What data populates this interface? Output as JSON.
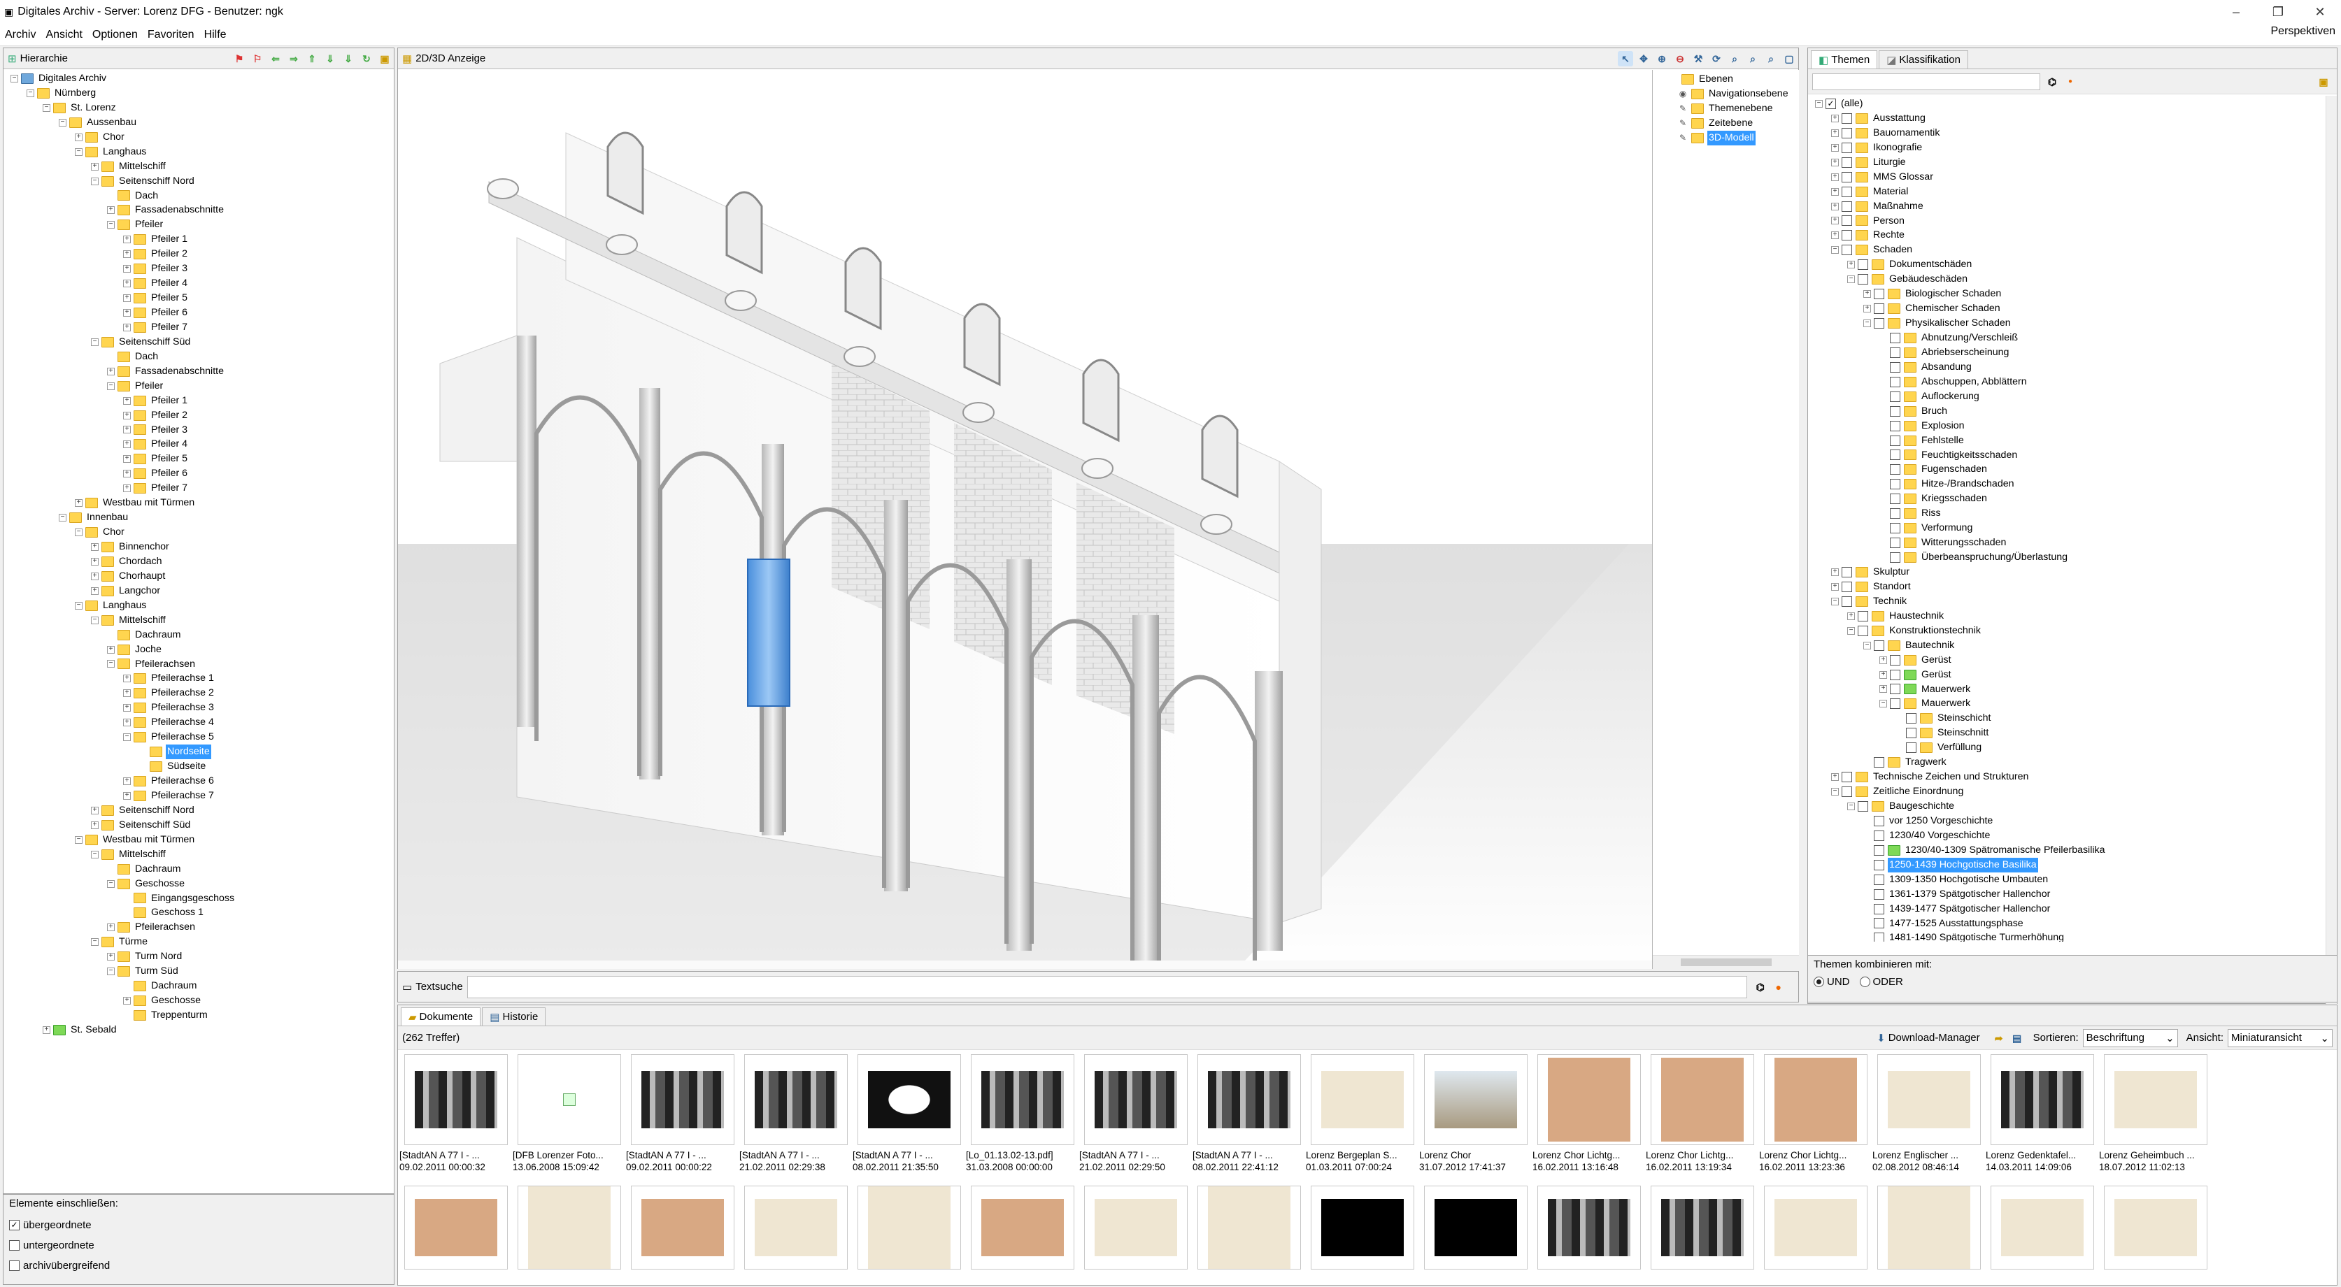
{
  "window": {
    "title": "Digitales Archiv - Server: Lorenz DFG - Benutzer: ngk",
    "controls": {
      "minimize": "–",
      "restore": "❐",
      "close": "✕"
    }
  },
  "menu": [
    "Archiv",
    "Ansicht",
    "Optionen",
    "Favoriten",
    "Hilfe"
  ],
  "perspektiven": "Perspektiven",
  "hierarchy": {
    "tab": "Hierarchie",
    "items": [
      {
        "d": 0,
        "e": "-",
        "i": "net",
        "t": "Digitales Archiv"
      },
      {
        "d": 1,
        "e": "-",
        "i": "f",
        "t": "Nürnberg"
      },
      {
        "d": 2,
        "e": "-",
        "i": "f",
        "t": "St. Lorenz"
      },
      {
        "d": 3,
        "e": "-",
        "i": "f",
        "t": "Aussenbau"
      },
      {
        "d": 4,
        "e": "+",
        "i": "f",
        "t": "Chor"
      },
      {
        "d": 4,
        "e": "-",
        "i": "f",
        "t": "Langhaus"
      },
      {
        "d": 5,
        "e": "+",
        "i": "f",
        "t": "Mittelschiff"
      },
      {
        "d": 5,
        "e": "-",
        "i": "f",
        "t": "Seitenschiff Nord"
      },
      {
        "d": 6,
        "e": "",
        "i": "f",
        "t": "Dach"
      },
      {
        "d": 6,
        "e": "+",
        "i": "f",
        "t": "Fassadenabschnitte"
      },
      {
        "d": 6,
        "e": "-",
        "i": "f",
        "t": "Pfeiler"
      },
      {
        "d": 7,
        "e": "+",
        "i": "f",
        "t": "Pfeiler 1"
      },
      {
        "d": 7,
        "e": "+",
        "i": "f",
        "t": "Pfeiler 2"
      },
      {
        "d": 7,
        "e": "+",
        "i": "f",
        "t": "Pfeiler 3"
      },
      {
        "d": 7,
        "e": "+",
        "i": "f",
        "t": "Pfeiler 4"
      },
      {
        "d": 7,
        "e": "+",
        "i": "f",
        "t": "Pfeiler 5"
      },
      {
        "d": 7,
        "e": "+",
        "i": "f",
        "t": "Pfeiler 6"
      },
      {
        "d": 7,
        "e": "+",
        "i": "f",
        "t": "Pfeiler 7"
      },
      {
        "d": 5,
        "e": "-",
        "i": "f",
        "t": "Seitenschiff Süd"
      },
      {
        "d": 6,
        "e": "",
        "i": "f",
        "t": "Dach"
      },
      {
        "d": 6,
        "e": "+",
        "i": "f",
        "t": "Fassadenabschnitte"
      },
      {
        "d": 6,
        "e": "-",
        "i": "f",
        "t": "Pfeiler"
      },
      {
        "d": 7,
        "e": "+",
        "i": "f",
        "t": "Pfeiler 1"
      },
      {
        "d": 7,
        "e": "+",
        "i": "f",
        "t": "Pfeiler 2"
      },
      {
        "d": 7,
        "e": "+",
        "i": "f",
        "t": "Pfeiler 3"
      },
      {
        "d": 7,
        "e": "+",
        "i": "f",
        "t": "Pfeiler 4"
      },
      {
        "d": 7,
        "e": "+",
        "i": "f",
        "t": "Pfeiler 5"
      },
      {
        "d": 7,
        "e": "+",
        "i": "f",
        "t": "Pfeiler 6"
      },
      {
        "d": 7,
        "e": "+",
        "i": "f",
        "t": "Pfeiler 7"
      },
      {
        "d": 4,
        "e": "+",
        "i": "f",
        "t": "Westbau mit Türmen"
      },
      {
        "d": 3,
        "e": "-",
        "i": "f",
        "t": "Innenbau"
      },
      {
        "d": 4,
        "e": "-",
        "i": "f",
        "t": "Chor"
      },
      {
        "d": 5,
        "e": "+",
        "i": "f",
        "t": "Binnenchor"
      },
      {
        "d": 5,
        "e": "+",
        "i": "f",
        "t": "Chordach"
      },
      {
        "d": 5,
        "e": "+",
        "i": "f",
        "t": "Chorhaupt"
      },
      {
        "d": 5,
        "e": "+",
        "i": "f",
        "t": "Langchor"
      },
      {
        "d": 4,
        "e": "-",
        "i": "f",
        "t": "Langhaus"
      },
      {
        "d": 5,
        "e": "-",
        "i": "f",
        "t": "Mittelschiff"
      },
      {
        "d": 6,
        "e": "",
        "i": "f",
        "t": "Dachraum"
      },
      {
        "d": 6,
        "e": "+",
        "i": "f",
        "t": "Joche"
      },
      {
        "d": 6,
        "e": "-",
        "i": "f",
        "t": "Pfeilerachsen"
      },
      {
        "d": 7,
        "e": "+",
        "i": "f",
        "t": "Pfeilerachse 1"
      },
      {
        "d": 7,
        "e": "+",
        "i": "f",
        "t": "Pfeilerachse 2"
      },
      {
        "d": 7,
        "e": "+",
        "i": "f",
        "t": "Pfeilerachse 3"
      },
      {
        "d": 7,
        "e": "+",
        "i": "f",
        "t": "Pfeilerachse 4"
      },
      {
        "d": 7,
        "e": "-",
        "i": "f",
        "t": "Pfeilerachse 5"
      },
      {
        "d": 8,
        "e": "",
        "i": "f",
        "t": "Nordseite",
        "s": true
      },
      {
        "d": 8,
        "e": "",
        "i": "f",
        "t": "Südseite"
      },
      {
        "d": 7,
        "e": "+",
        "i": "f",
        "t": "Pfeilerachse 6"
      },
      {
        "d": 7,
        "e": "+",
        "i": "f",
        "t": "Pfeilerachse 7"
      },
      {
        "d": 5,
        "e": "+",
        "i": "f",
        "t": "Seitenschiff Nord"
      },
      {
        "d": 5,
        "e": "+",
        "i": "f",
        "t": "Seitenschiff Süd"
      },
      {
        "d": 4,
        "e": "-",
        "i": "f",
        "t": "Westbau mit Türmen"
      },
      {
        "d": 5,
        "e": "-",
        "i": "f",
        "t": "Mittelschiff"
      },
      {
        "d": 6,
        "e": "",
        "i": "f",
        "t": "Dachraum"
      },
      {
        "d": 6,
        "e": "-",
        "i": "f",
        "t": "Geschosse"
      },
      {
        "d": 7,
        "e": "",
        "i": "f",
        "t": "Eingangsgeschoss"
      },
      {
        "d": 7,
        "e": "",
        "i": "f",
        "t": "Geschoss 1"
      },
      {
        "d": 6,
        "e": "+",
        "i": "f",
        "t": "Pfeilerachsen"
      },
      {
        "d": 5,
        "e": "-",
        "i": "f",
        "t": "Türme"
      },
      {
        "d": 6,
        "e": "+",
        "i": "f",
        "t": "Turm Nord"
      },
      {
        "d": 6,
        "e": "-",
        "i": "f",
        "t": "Turm Süd"
      },
      {
        "d": 7,
        "e": "",
        "i": "f",
        "t": "Dachraum"
      },
      {
        "d": 7,
        "e": "+",
        "i": "f",
        "t": "Geschosse"
      },
      {
        "d": 7,
        "e": "",
        "i": "f",
        "t": "Treppenturm"
      },
      {
        "d": 2,
        "e": "+",
        "i": "g",
        "t": "St. Sebald"
      }
    ],
    "include_label": "Elemente einschließen:",
    "include_options": [
      {
        "label": "übergeordnete",
        "checked": true
      },
      {
        "label": "untergeordnete",
        "checked": false
      },
      {
        "label": "archivübergreifend",
        "checked": false
      }
    ]
  },
  "viewer": {
    "tab": "2D/3D Anzeige"
  },
  "layers": [
    {
      "d": 0,
      "t": "Ebenen",
      "eye": false
    },
    {
      "d": 1,
      "t": "Navigationsebene",
      "eye": true
    },
    {
      "d": 1,
      "t": "Themenebene",
      "eye": false
    },
    {
      "d": 1,
      "t": "Zeitebene",
      "eye": false
    },
    {
      "d": 1,
      "t": "3D-Modell",
      "eye": false,
      "s": true
    }
  ],
  "themes": {
    "tabs": [
      "Themen",
      "Klassifikation"
    ],
    "items": [
      {
        "d": 0,
        "e": "-",
        "c": "x",
        "t": "(alle)",
        "i": "none"
      },
      {
        "d": 1,
        "e": "+",
        "t": "Ausstattung"
      },
      {
        "d": 1,
        "e": "+",
        "t": "Bauornamentik"
      },
      {
        "d": 1,
        "e": "+",
        "t": "Ikonografie"
      },
      {
        "d": 1,
        "e": "+",
        "t": "Liturgie"
      },
      {
        "d": 1,
        "e": "+",
        "t": "MMS Glossar"
      },
      {
        "d": 1,
        "e": "+",
        "t": "Material"
      },
      {
        "d": 1,
        "e": "+",
        "t": "Maßnahme"
      },
      {
        "d": 1,
        "e": "+",
        "t": "Person"
      },
      {
        "d": 1,
        "e": "+",
        "t": "Rechte"
      },
      {
        "d": 1,
        "e": "-",
        "t": "Schaden"
      },
      {
        "d": 2,
        "e": "+",
        "t": "Dokumentschäden"
      },
      {
        "d": 2,
        "e": "-",
        "t": "Gebäudeschäden"
      },
      {
        "d": 3,
        "e": "+",
        "t": "Biologischer Schaden"
      },
      {
        "d": 3,
        "e": "+",
        "t": "Chemischer Schaden"
      },
      {
        "d": 3,
        "e": "-",
        "t": "Physikalischer Schaden"
      },
      {
        "d": 4,
        "e": "",
        "t": "Abnutzung/Verschleiß"
      },
      {
        "d": 4,
        "e": "",
        "t": "Abriebserscheinung"
      },
      {
        "d": 4,
        "e": "",
        "t": "Absandung"
      },
      {
        "d": 4,
        "e": "",
        "t": "Abschuppen, Abblättern"
      },
      {
        "d": 4,
        "e": "",
        "t": "Auflockerung"
      },
      {
        "d": 4,
        "e": "",
        "t": "Bruch"
      },
      {
        "d": 4,
        "e": "",
        "t": "Explosion"
      },
      {
        "d": 4,
        "e": "",
        "t": "Fehlstelle"
      },
      {
        "d": 4,
        "e": "",
        "t": "Feuchtigkeitsschaden"
      },
      {
        "d": 4,
        "e": "",
        "t": "Fugenschaden"
      },
      {
        "d": 4,
        "e": "",
        "t": "Hitze-/Brandschaden"
      },
      {
        "d": 4,
        "e": "",
        "t": "Kriegsschaden"
      },
      {
        "d": 4,
        "e": "",
        "t": "Riss"
      },
      {
        "d": 4,
        "e": "",
        "t": "Verformung"
      },
      {
        "d": 4,
        "e": "",
        "t": "Witterungsschaden"
      },
      {
        "d": 4,
        "e": "",
        "t": "Überbeanspruchung/Überlastung"
      },
      {
        "d": 1,
        "e": "+",
        "t": "Skulptur"
      },
      {
        "d": 1,
        "e": "+",
        "t": "Standort"
      },
      {
        "d": 1,
        "e": "-",
        "t": "Technik"
      },
      {
        "d": 2,
        "e": "+",
        "t": "Haustechnik"
      },
      {
        "d": 2,
        "e": "-",
        "t": "Konstruktionstechnik"
      },
      {
        "d": 3,
        "e": "-",
        "t": "Bautechnik"
      },
      {
        "d": 4,
        "e": "+",
        "t": "Gerüst"
      },
      {
        "d": 4,
        "e": "+",
        "t": "Gerüst",
        "i": "g"
      },
      {
        "d": 4,
        "e": "+",
        "t": "Mauerwerk",
        "i": "g"
      },
      {
        "d": 4,
        "e": "-",
        "t": "Mauerwerk"
      },
      {
        "d": 5,
        "e": "",
        "t": "Steinschicht"
      },
      {
        "d": 5,
        "e": "",
        "t": "Steinschnitt"
      },
      {
        "d": 5,
        "e": "",
        "t": "Verfüllung"
      },
      {
        "d": 3,
        "e": "",
        "t": "Tragwerk"
      },
      {
        "d": 1,
        "e": "+",
        "t": "Technische Zeichen und Strukturen"
      },
      {
        "d": 1,
        "e": "-",
        "t": "Zeitliche Einordnung"
      },
      {
        "d": 2,
        "e": "-",
        "t": "Baugeschichte"
      },
      {
        "d": 3,
        "e": "",
        "t": "vor 1250 Vorgeschichte",
        "i": "none"
      },
      {
        "d": 3,
        "e": "",
        "t": "1230/40 Vorgeschichte",
        "i": "none"
      },
      {
        "d": 3,
        "e": "",
        "t": "1230/40-1309 Spätromanische Pfeilerbasilika",
        "i": "g"
      },
      {
        "d": 3,
        "e": "",
        "t": "1250-1439 Hochgotische Basilika",
        "i": "none",
        "s": true
      },
      {
        "d": 3,
        "e": "",
        "t": "1309-1350 Hochgotische Umbauten",
        "i": "none"
      },
      {
        "d": 3,
        "e": "",
        "t": "1361-1379 Spätgotischer Hallenchor",
        "i": "none"
      },
      {
        "d": 3,
        "e": "",
        "t": "1439-1477 Spätgotischer Hallenchor",
        "i": "none"
      },
      {
        "d": 3,
        "e": "",
        "t": "1477-1525 Ausstattungsphase",
        "i": "none"
      },
      {
        "d": 3,
        "e": "",
        "t": "1481-1490 Spätgotische Turmerhöhung",
        "i": "none"
      }
    ],
    "combine_label": "Themen kombinieren mit:",
    "combine_options": [
      {
        "label": "UND",
        "checked": true
      },
      {
        "label": "ODER",
        "checked": false
      }
    ]
  },
  "search": {
    "tab": "Textsuche",
    "value": ""
  },
  "docs": {
    "tabs": [
      "Dokumente",
      "Historie"
    ],
    "count": "(262 Treffer)",
    "download": "Download-Manager",
    "sort_label": "Sortieren:",
    "sort_value": "Beschriftung",
    "view_label": "Ansicht:",
    "view_value": "Miniaturansicht",
    "row1": [
      {
        "n": "[StadtAN A 77 I - ...",
        "d": "09.02.2011 00:00:32",
        "k": "photo"
      },
      {
        "n": "[DFB Lorenzer Foto...",
        "d": "13.06.2008 15:09:42",
        "k": "icon"
      },
      {
        "n": "[StadtAN A 77 I - ...",
        "d": "09.02.2011 00:00:22",
        "k": "photo"
      },
      {
        "n": "[StadtAN A 77 I - ...",
        "d": "21.02.2011 02:29:38",
        "k": "photo"
      },
      {
        "n": "[StadtAN A 77 I - ...",
        "d": "08.02.2011 21:35:50",
        "k": "plan"
      },
      {
        "n": "[Lo_01.13.02-13.pdf]",
        "d": "31.03.2008 00:00:00",
        "k": "photo"
      },
      {
        "n": "[StadtAN A 77 I - ...",
        "d": "21.02.2011 02:29:50",
        "k": "photo"
      },
      {
        "n": "[StadtAN A 77 I - ...",
        "d": "08.02.2011 22:41:12",
        "k": "photo"
      },
      {
        "n": "Lorenz Bergeplan S...",
        "d": "01.03.2011 07:00:24",
        "k": "paper"
      },
      {
        "n": "Lorenz Chor",
        "d": "31.07.2012 17:41:37",
        "k": "color"
      },
      {
        "n": "Lorenz Chor Lichtg...",
        "d": "16.02.2011 13:16:48",
        "k": "brown"
      },
      {
        "n": "Lorenz Chor Lichtg...",
        "d": "16.02.2011 13:19:34",
        "k": "brown"
      },
      {
        "n": "Lorenz Chor Lichtg...",
        "d": "16.02.2011 13:23:36",
        "k": "brown"
      },
      {
        "n": "Lorenz Englischer ...",
        "d": "02.08.2012 08:46:14",
        "k": "paper"
      },
      {
        "n": "Lorenz Gedenktafel...",
        "d": "14.03.2011 14:09:06",
        "k": "photo"
      },
      {
        "n": "Lorenz Geheimbuch ...",
        "d": "18.07.2012 11:02:13",
        "k": "paper"
      }
    ],
    "row2": [
      "brown",
      "paper",
      "brown",
      "paper",
      "paper",
      "brown",
      "paper",
      "paper",
      "black",
      "black",
      "photo",
      "photo",
      "paper",
      "paper",
      "paper",
      "paper"
    ]
  }
}
